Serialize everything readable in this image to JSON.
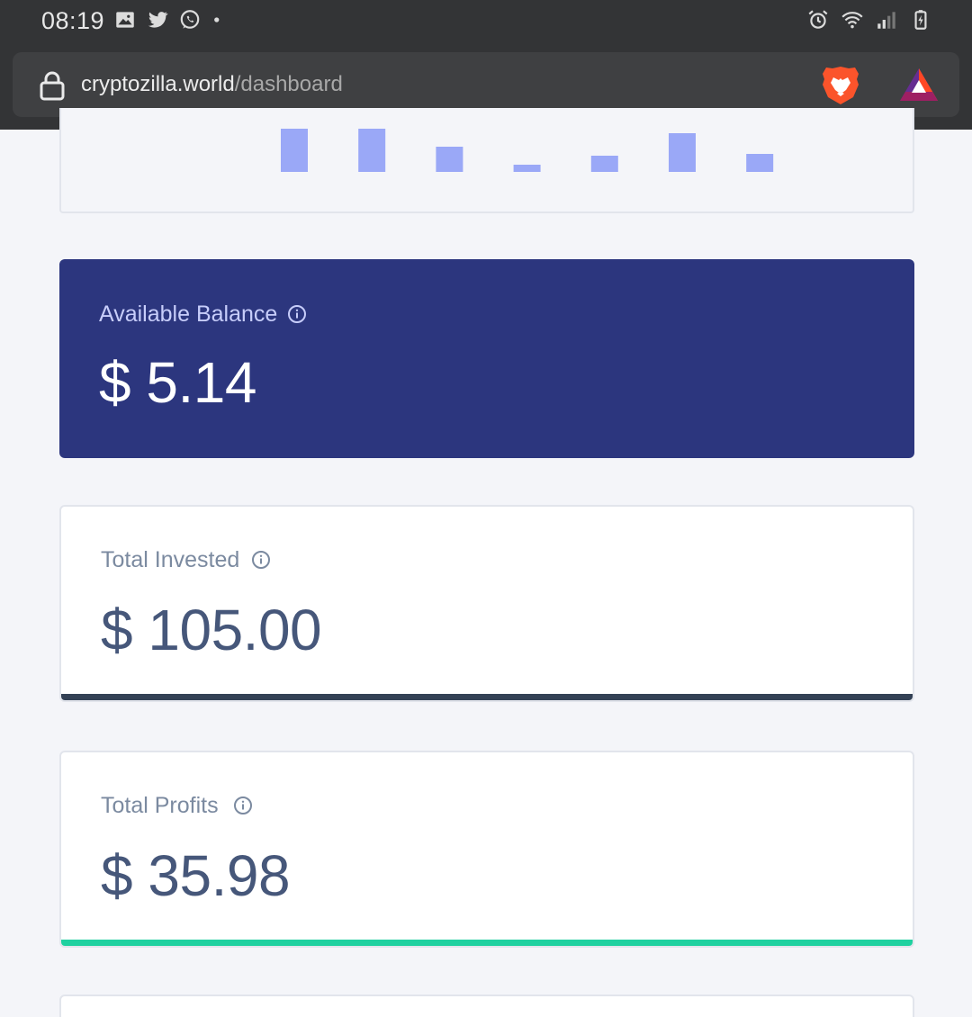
{
  "status_bar": {
    "time": "08:19",
    "left_icons": [
      "gallery-icon",
      "twitter-icon",
      "whatsapp-icon",
      "notification-dot-icon"
    ],
    "right_icons": [
      "alarm-icon",
      "wifi-icon",
      "signal-icon",
      "battery-charging-icon"
    ]
  },
  "browser": {
    "url_domain": "cryptozilla.world",
    "url_path": "/dashboard",
    "icons": [
      "lock-icon",
      "brave-lion-icon",
      "brave-rewards-icon"
    ]
  },
  "chart_data": {
    "type": "bar",
    "bar_color": "#9aa8f7",
    "values": [
      0.96,
      0.96,
      0.56,
      0.16,
      0.36,
      0.86,
      0.4
    ],
    "note_visible": "chart is scrolled so only the lower portion of bars is visible"
  },
  "cards": {
    "balance": {
      "label": "Available Balance",
      "value": "$ 5.14",
      "background": "#2c367e"
    },
    "invested": {
      "label": "Total Invested",
      "value": "$ 105.00",
      "accent": "#334155"
    },
    "profits": {
      "label": "Total Profits",
      "value": "$ 35.98",
      "accent": "#1fd1a0"
    }
  }
}
